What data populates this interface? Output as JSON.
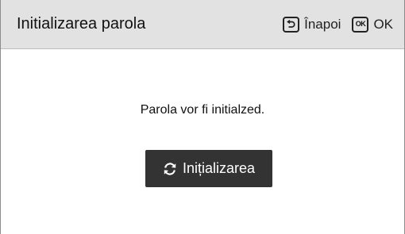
{
  "dialog": {
    "title": "Initializarea parola"
  },
  "header_actions": {
    "back": {
      "icon": "back-key-icon",
      "label": "Înapoi"
    },
    "ok": {
      "icon": "ok-key-icon",
      "key_text": "OK",
      "label": "OK"
    }
  },
  "message": "Parola vor fi initialzed.",
  "primary_button": {
    "icon": "refresh-icon",
    "label": "Inițializarea"
  },
  "colors": {
    "header_bg": "#e2e2e2",
    "button_bg": "#333333",
    "button_text": "#ffffff"
  }
}
